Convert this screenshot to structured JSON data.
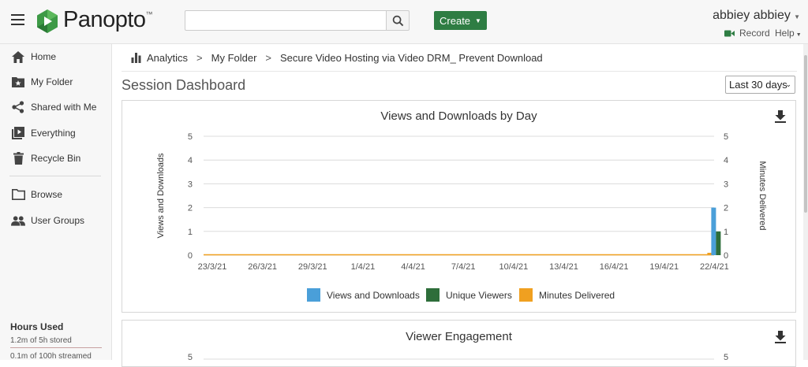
{
  "header": {
    "logo_text": "Panopto",
    "logo_mark": "™",
    "search": {
      "value": "",
      "placeholder": ""
    },
    "create_label": "Create",
    "user_name": "abbiey abbiey",
    "record_label": "Record",
    "help_label": "Help"
  },
  "sidebar": {
    "items": [
      {
        "label": "Home",
        "icon": "home-icon"
      },
      {
        "label": "My Folder",
        "icon": "folder-star-icon"
      },
      {
        "label": "Shared with Me",
        "icon": "share-icon"
      },
      {
        "label": "Everything",
        "icon": "video-library-icon"
      },
      {
        "label": "Recycle Bin",
        "icon": "trash-icon"
      },
      {
        "label": "Browse",
        "icon": "folder-icon"
      },
      {
        "label": "User Groups",
        "icon": "users-icon"
      }
    ],
    "hours": {
      "title": "Hours Used",
      "stored": "1.2m of 5h stored",
      "streamed": "0.1m of 100h streamed"
    }
  },
  "breadcrumb": {
    "items": [
      "Analytics",
      "My Folder",
      "Secure Video Hosting via Video DRM_ Prevent Download"
    ],
    "separator": ">"
  },
  "page_title": "Session Dashboard",
  "date_range": "Last 30 days",
  "colors": {
    "views": "#4a9fd9",
    "unique": "#2e6e3a",
    "minutes": "#f0a020",
    "brand_green": "#2e7d43"
  },
  "chart_data": [
    {
      "type": "bar",
      "title": "Views and Downloads by Day",
      "ylabel": "Views and Downloads",
      "y2label": "Minutes Delivered",
      "ylim": [
        0,
        5
      ],
      "y2lim": [
        0,
        5
      ],
      "yticks": [
        "0",
        "1",
        "2",
        "3",
        "4",
        "5"
      ],
      "categories": [
        "23/3/21",
        "26/3/21",
        "29/3/21",
        "1/4/21",
        "4/4/21",
        "7/4/21",
        "10/4/21",
        "13/4/21",
        "16/4/21",
        "19/4/21",
        "22/4/21"
      ],
      "last_day": "22/4/21",
      "series": [
        {
          "name": "Views and Downloads",
          "color": "#4a9fd9",
          "last_day_value": 2
        },
        {
          "name": "Unique Viewers",
          "color": "#2e6e3a",
          "last_day_value": 1
        },
        {
          "name": "Minutes Delivered",
          "color": "#f0a020",
          "last_day_value": 0.1
        }
      ],
      "grid": true,
      "legend": "bottom"
    },
    {
      "type": "bar",
      "title": "Viewer Engagement",
      "yticks_visible": [
        "5"
      ],
      "ylim": [
        0,
        5
      ]
    }
  ]
}
